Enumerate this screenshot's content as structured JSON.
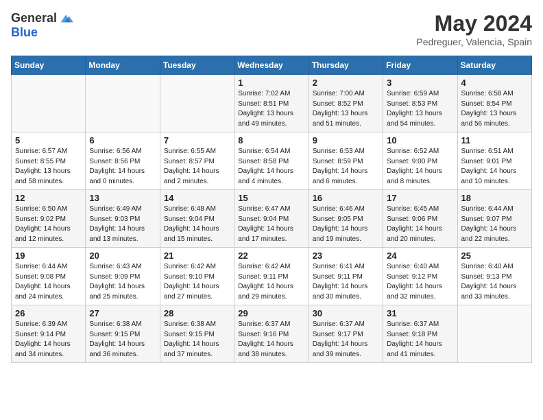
{
  "logo": {
    "general": "General",
    "blue": "Blue"
  },
  "title": "May 2024",
  "location": "Pedreguer, Valencia, Spain",
  "headers": [
    "Sunday",
    "Monday",
    "Tuesday",
    "Wednesday",
    "Thursday",
    "Friday",
    "Saturday"
  ],
  "weeks": [
    [
      {
        "day": "",
        "info": ""
      },
      {
        "day": "",
        "info": ""
      },
      {
        "day": "",
        "info": ""
      },
      {
        "day": "1",
        "info": "Sunrise: 7:02 AM\nSunset: 8:51 PM\nDaylight: 13 hours\nand 49 minutes."
      },
      {
        "day": "2",
        "info": "Sunrise: 7:00 AM\nSunset: 8:52 PM\nDaylight: 13 hours\nand 51 minutes."
      },
      {
        "day": "3",
        "info": "Sunrise: 6:59 AM\nSunset: 8:53 PM\nDaylight: 13 hours\nand 54 minutes."
      },
      {
        "day": "4",
        "info": "Sunrise: 6:58 AM\nSunset: 8:54 PM\nDaylight: 13 hours\nand 56 minutes."
      }
    ],
    [
      {
        "day": "5",
        "info": "Sunrise: 6:57 AM\nSunset: 8:55 PM\nDaylight: 13 hours\nand 58 minutes."
      },
      {
        "day": "6",
        "info": "Sunrise: 6:56 AM\nSunset: 8:56 PM\nDaylight: 14 hours\nand 0 minutes."
      },
      {
        "day": "7",
        "info": "Sunrise: 6:55 AM\nSunset: 8:57 PM\nDaylight: 14 hours\nand 2 minutes."
      },
      {
        "day": "8",
        "info": "Sunrise: 6:54 AM\nSunset: 8:58 PM\nDaylight: 14 hours\nand 4 minutes."
      },
      {
        "day": "9",
        "info": "Sunrise: 6:53 AM\nSunset: 8:59 PM\nDaylight: 14 hours\nand 6 minutes."
      },
      {
        "day": "10",
        "info": "Sunrise: 6:52 AM\nSunset: 9:00 PM\nDaylight: 14 hours\nand 8 minutes."
      },
      {
        "day": "11",
        "info": "Sunrise: 6:51 AM\nSunset: 9:01 PM\nDaylight: 14 hours\nand 10 minutes."
      }
    ],
    [
      {
        "day": "12",
        "info": "Sunrise: 6:50 AM\nSunset: 9:02 PM\nDaylight: 14 hours\nand 12 minutes."
      },
      {
        "day": "13",
        "info": "Sunrise: 6:49 AM\nSunset: 9:03 PM\nDaylight: 14 hours\nand 13 minutes."
      },
      {
        "day": "14",
        "info": "Sunrise: 6:48 AM\nSunset: 9:04 PM\nDaylight: 14 hours\nand 15 minutes."
      },
      {
        "day": "15",
        "info": "Sunrise: 6:47 AM\nSunset: 9:04 PM\nDaylight: 14 hours\nand 17 minutes."
      },
      {
        "day": "16",
        "info": "Sunrise: 6:46 AM\nSunset: 9:05 PM\nDaylight: 14 hours\nand 19 minutes."
      },
      {
        "day": "17",
        "info": "Sunrise: 6:45 AM\nSunset: 9:06 PM\nDaylight: 14 hours\nand 20 minutes."
      },
      {
        "day": "18",
        "info": "Sunrise: 6:44 AM\nSunset: 9:07 PM\nDaylight: 14 hours\nand 22 minutes."
      }
    ],
    [
      {
        "day": "19",
        "info": "Sunrise: 6:44 AM\nSunset: 9:08 PM\nDaylight: 14 hours\nand 24 minutes."
      },
      {
        "day": "20",
        "info": "Sunrise: 6:43 AM\nSunset: 9:09 PM\nDaylight: 14 hours\nand 25 minutes."
      },
      {
        "day": "21",
        "info": "Sunrise: 6:42 AM\nSunset: 9:10 PM\nDaylight: 14 hours\nand 27 minutes."
      },
      {
        "day": "22",
        "info": "Sunrise: 6:42 AM\nSunset: 9:11 PM\nDaylight: 14 hours\nand 29 minutes."
      },
      {
        "day": "23",
        "info": "Sunrise: 6:41 AM\nSunset: 9:11 PM\nDaylight: 14 hours\nand 30 minutes."
      },
      {
        "day": "24",
        "info": "Sunrise: 6:40 AM\nSunset: 9:12 PM\nDaylight: 14 hours\nand 32 minutes."
      },
      {
        "day": "25",
        "info": "Sunrise: 6:40 AM\nSunset: 9:13 PM\nDaylight: 14 hours\nand 33 minutes."
      }
    ],
    [
      {
        "day": "26",
        "info": "Sunrise: 6:39 AM\nSunset: 9:14 PM\nDaylight: 14 hours\nand 34 minutes."
      },
      {
        "day": "27",
        "info": "Sunrise: 6:38 AM\nSunset: 9:15 PM\nDaylight: 14 hours\nand 36 minutes."
      },
      {
        "day": "28",
        "info": "Sunrise: 6:38 AM\nSunset: 9:15 PM\nDaylight: 14 hours\nand 37 minutes."
      },
      {
        "day": "29",
        "info": "Sunrise: 6:37 AM\nSunset: 9:16 PM\nDaylight: 14 hours\nand 38 minutes."
      },
      {
        "day": "30",
        "info": "Sunrise: 6:37 AM\nSunset: 9:17 PM\nDaylight: 14 hours\nand 39 minutes."
      },
      {
        "day": "31",
        "info": "Sunrise: 6:37 AM\nSunset: 9:18 PM\nDaylight: 14 hours\nand 41 minutes."
      },
      {
        "day": "",
        "info": ""
      }
    ]
  ]
}
